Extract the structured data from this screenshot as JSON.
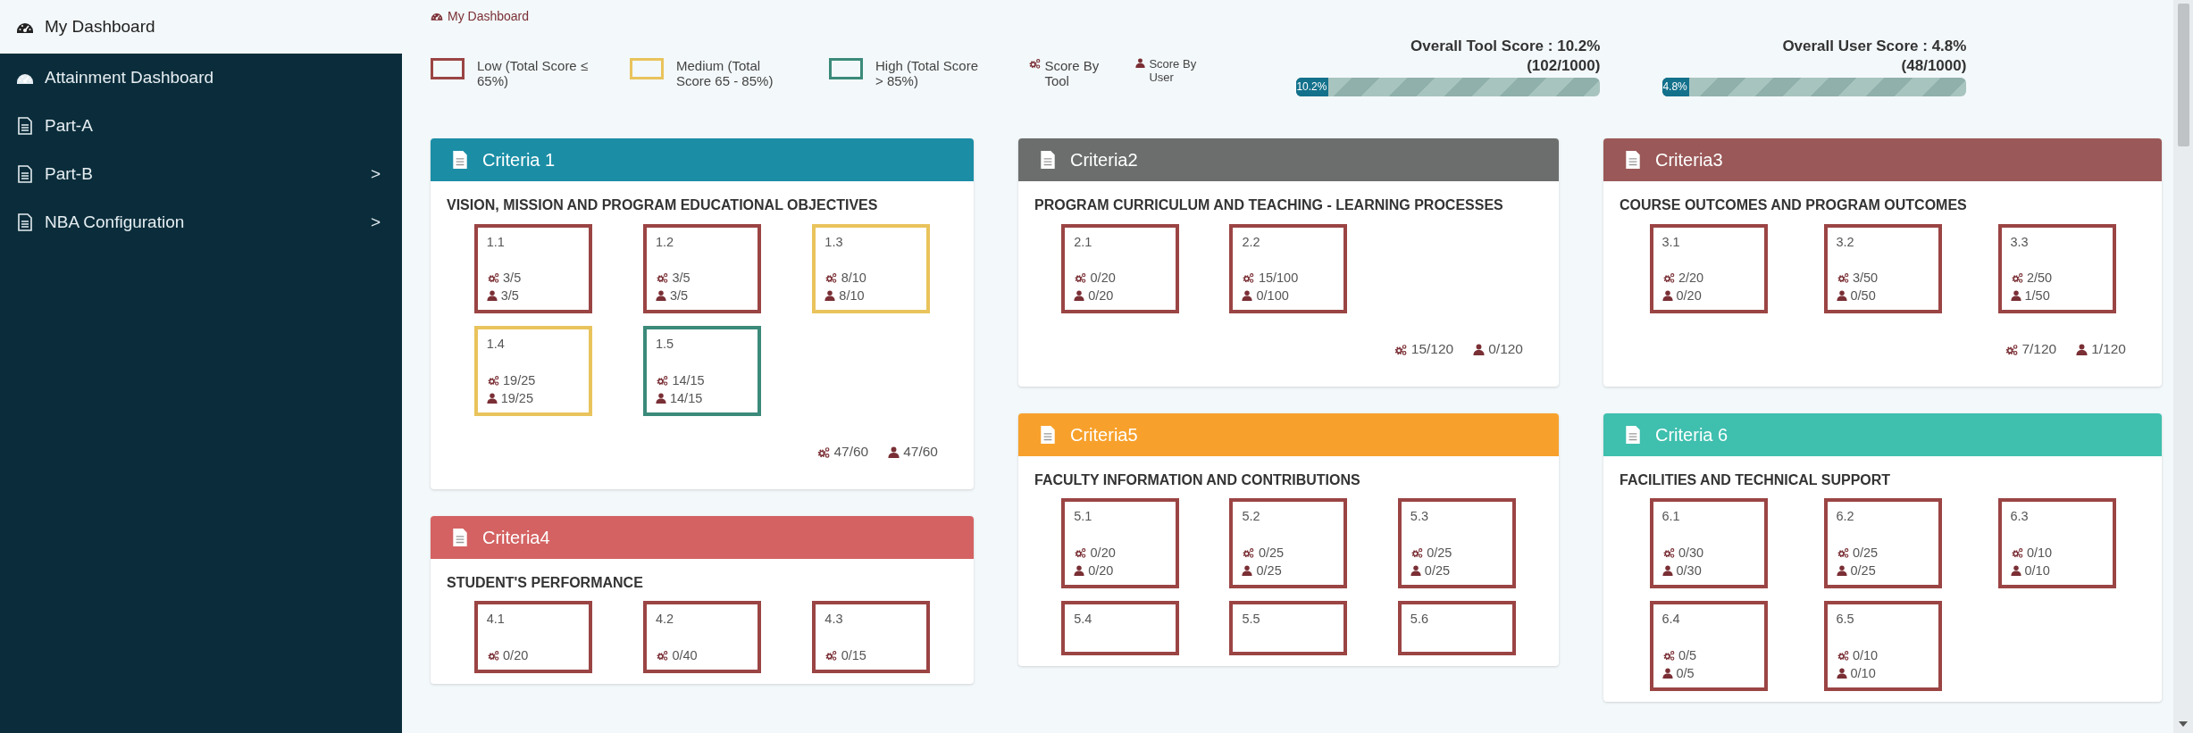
{
  "sidebar": {
    "items": [
      {
        "label": "My Dashboard",
        "kind": "dashboard",
        "selected": true
      },
      {
        "label": "Attainment Dashboard",
        "kind": "dashboard",
        "selected": false
      },
      {
        "label": "Part-A",
        "kind": "document",
        "selected": false
      },
      {
        "label": "Part-B",
        "kind": "document",
        "selected": false,
        "arrow": ">"
      },
      {
        "label": "NBA Configuration",
        "kind": "document",
        "selected": false,
        "arrow": ">"
      }
    ]
  },
  "breadcrumb": {
    "label": "My Dashboard"
  },
  "legend": {
    "bands": [
      {
        "color": "#9b4444",
        "label": "Low (Total Score ≤ 65%)"
      },
      {
        "color": "#e9c35c",
        "label": "Medium (Total Score 65 - 85%)"
      },
      {
        "color": "#3b8a7a",
        "label": "High (Total Score > 85%)"
      }
    ],
    "scores": [
      {
        "kind": "tool",
        "label": "Score By Tool"
      },
      {
        "kind": "user",
        "label": "Score By User"
      }
    ]
  },
  "overall": [
    {
      "title": "Overall Tool Score : 10.2%",
      "detail": "(102/1000)",
      "level": 0.102,
      "reading": "10.2%"
    },
    {
      "title": "Overall User Score : 4.8%",
      "detail": "(48/1000)",
      "level": 0.048,
      "reading": "4.8%"
    }
  ],
  "columns": [
    [
      {
        "title": "Criteria 1",
        "color": "#1b8ea6",
        "heading": "VISION, MISSION AND PROGRAM EDUCATIONAL OBJECTIVES",
        "items": [
          {
            "label": "1.1",
            "color": "#9b4444",
            "tool": "3/5",
            "user": "3/5"
          },
          {
            "label": "1.2",
            "color": "#9b4444",
            "tool": "3/5",
            "user": "3/5"
          },
          {
            "label": "1.3",
            "color": "#e9c35c",
            "tool": "8/10",
            "user": "8/10"
          },
          {
            "label": "1.4",
            "color": "#e9c35c",
            "tool": "19/25",
            "user": "19/25"
          },
          {
            "label": "1.5",
            "color": "#3b8a7a",
            "tool": "14/15",
            "user": "14/15"
          }
        ],
        "total_tool": "47/60",
        "total_user": "47/60"
      },
      {
        "title": "Criteria4",
        "color": "#d46262",
        "heading": "STUDENT'S PERFORMANCE",
        "items": [
          {
            "label": "4.1",
            "color": "#9b4444",
            "tool": "0/20"
          },
          {
            "label": "4.2",
            "color": "#9b4444",
            "tool": "0/40"
          },
          {
            "label": "4.3",
            "color": "#9b4444",
            "tool": "0/15"
          }
        ]
      }
    ],
    [
      {
        "title": "Criteria2",
        "color": "#6c6e6e",
        "heading": "PROGRAM CURRICULUM AND TEACHING - LEARNING PROCESSES",
        "items": [
          {
            "label": "2.1",
            "color": "#9b4444",
            "tool": "0/20",
            "user": "0/20"
          },
          {
            "label": "2.2",
            "color": "#9b4444",
            "tool": "15/100",
            "user": "0/100"
          }
        ],
        "total_tool": "15/120",
        "total_user": "0/120"
      },
      {
        "title": "Criteria5",
        "color": "#f7a12c",
        "heading": "FACULTY INFORMATION AND CONTRIBUTIONS",
        "items": [
          {
            "label": "5.1",
            "color": "#9b4444",
            "tool": "0/20",
            "user": "0/20"
          },
          {
            "label": "5.2",
            "color": "#9b4444",
            "tool": "0/25",
            "user": "0/25"
          },
          {
            "label": "5.3",
            "color": "#9b4444",
            "tool": "0/25",
            "user": "0/25"
          },
          {
            "label": "5.4",
            "color": "#9b4444"
          },
          {
            "label": "5.5",
            "color": "#9b4444"
          },
          {
            "label": "5.6",
            "color": "#9b4444"
          }
        ]
      }
    ],
    [
      {
        "title": "Criteria3",
        "color": "#9a5858",
        "heading": "COURSE OUTCOMES AND PROGRAM OUTCOMES",
        "items": [
          {
            "label": "3.1",
            "color": "#9b4444",
            "tool": "2/20",
            "user": "0/20"
          },
          {
            "label": "3.2",
            "color": "#9b4444",
            "tool": "3/50",
            "user": "0/50"
          },
          {
            "label": "3.3",
            "color": "#9b4444",
            "tool": "2/50",
            "user": "1/50"
          }
        ],
        "total_tool": "7/120",
        "total_user": "1/120"
      },
      {
        "title": "Criteria 6",
        "color": "#3fbfae",
        "heading": "FACILITIES AND TECHNICAL SUPPORT",
        "items": [
          {
            "label": "6.1",
            "color": "#9b4444",
            "tool": "0/30",
            "user": "0/30"
          },
          {
            "label": "6.2",
            "color": "#9b4444",
            "tool": "0/25",
            "user": "0/25"
          },
          {
            "label": "6.3",
            "color": "#9b4444",
            "tool": "0/10",
            "user": "0/10"
          },
          {
            "label": "6.4",
            "color": "#9b4444",
            "tool": "0/5",
            "user": "0/5"
          },
          {
            "label": "6.5",
            "color": "#9b4444",
            "tool": "0/10",
            "user": "0/10"
          }
        ]
      }
    ]
  ]
}
